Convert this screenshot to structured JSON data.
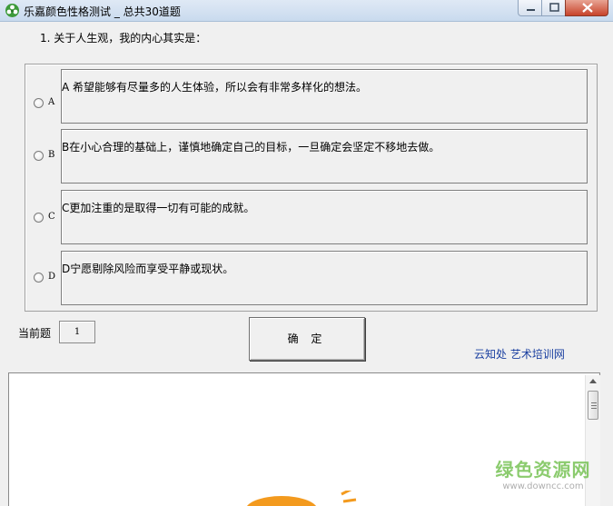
{
  "window": {
    "title": "乐嘉颜色性格测试 _ 总共30道题"
  },
  "question": {
    "text": "1. 关于人生观，我的内心其实是："
  },
  "options": [
    {
      "radio_label": "A",
      "text": "A 希望能够有尽量多的人生体验，所以会有非常多样化的想法。"
    },
    {
      "radio_label": "B",
      "text": "B在小心合理的基础上，谨慎地确定自己的目标，一旦确定会坚定不移地去做。"
    },
    {
      "radio_label": "C",
      "text": "C更加注重的是取得一切有可能的成就。"
    },
    {
      "radio_label": "D",
      "text": "D宁愿剔除风险而享受平静或现状。"
    }
  ],
  "current": {
    "label": "当前题",
    "value": "1"
  },
  "confirm_button": "确 定",
  "links": "云知处  艺术培训网",
  "watermark": {
    "main": "绿色资源网",
    "sub": "www.downcc.com"
  },
  "colors": {
    "link": "#1a3fa0",
    "watermark": "#6fbf4a",
    "sun": "#f39a1e"
  },
  "icons": {
    "app": "app-logo-icon",
    "minimize": "minimize-icon",
    "maximize": "maximize-icon",
    "close": "close-icon"
  }
}
